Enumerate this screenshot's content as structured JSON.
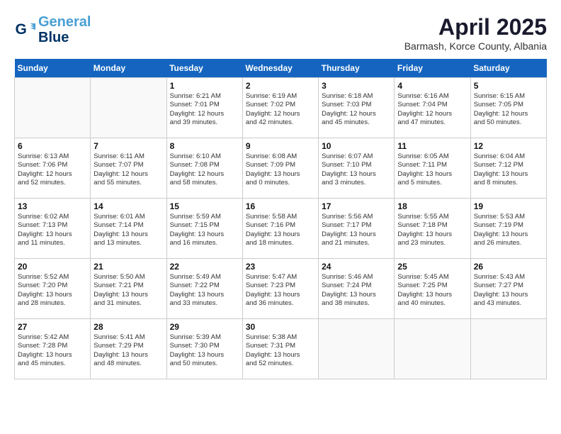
{
  "logo": {
    "line1": "General",
    "line2": "Blue"
  },
  "title": "April 2025",
  "subtitle": "Barmash, Korce County, Albania",
  "headers": [
    "Sunday",
    "Monday",
    "Tuesday",
    "Wednesday",
    "Thursday",
    "Friday",
    "Saturday"
  ],
  "weeks": [
    [
      {
        "day": "",
        "info": ""
      },
      {
        "day": "",
        "info": ""
      },
      {
        "day": "1",
        "info": "Sunrise: 6:21 AM\nSunset: 7:01 PM\nDaylight: 12 hours\nand 39 minutes."
      },
      {
        "day": "2",
        "info": "Sunrise: 6:19 AM\nSunset: 7:02 PM\nDaylight: 12 hours\nand 42 minutes."
      },
      {
        "day": "3",
        "info": "Sunrise: 6:18 AM\nSunset: 7:03 PM\nDaylight: 12 hours\nand 45 minutes."
      },
      {
        "day": "4",
        "info": "Sunrise: 6:16 AM\nSunset: 7:04 PM\nDaylight: 12 hours\nand 47 minutes."
      },
      {
        "day": "5",
        "info": "Sunrise: 6:15 AM\nSunset: 7:05 PM\nDaylight: 12 hours\nand 50 minutes."
      }
    ],
    [
      {
        "day": "6",
        "info": "Sunrise: 6:13 AM\nSunset: 7:06 PM\nDaylight: 12 hours\nand 52 minutes."
      },
      {
        "day": "7",
        "info": "Sunrise: 6:11 AM\nSunset: 7:07 PM\nDaylight: 12 hours\nand 55 minutes."
      },
      {
        "day": "8",
        "info": "Sunrise: 6:10 AM\nSunset: 7:08 PM\nDaylight: 12 hours\nand 58 minutes."
      },
      {
        "day": "9",
        "info": "Sunrise: 6:08 AM\nSunset: 7:09 PM\nDaylight: 13 hours\nand 0 minutes."
      },
      {
        "day": "10",
        "info": "Sunrise: 6:07 AM\nSunset: 7:10 PM\nDaylight: 13 hours\nand 3 minutes."
      },
      {
        "day": "11",
        "info": "Sunrise: 6:05 AM\nSunset: 7:11 PM\nDaylight: 13 hours\nand 5 minutes."
      },
      {
        "day": "12",
        "info": "Sunrise: 6:04 AM\nSunset: 7:12 PM\nDaylight: 13 hours\nand 8 minutes."
      }
    ],
    [
      {
        "day": "13",
        "info": "Sunrise: 6:02 AM\nSunset: 7:13 PM\nDaylight: 13 hours\nand 11 minutes."
      },
      {
        "day": "14",
        "info": "Sunrise: 6:01 AM\nSunset: 7:14 PM\nDaylight: 13 hours\nand 13 minutes."
      },
      {
        "day": "15",
        "info": "Sunrise: 5:59 AM\nSunset: 7:15 PM\nDaylight: 13 hours\nand 16 minutes."
      },
      {
        "day": "16",
        "info": "Sunrise: 5:58 AM\nSunset: 7:16 PM\nDaylight: 13 hours\nand 18 minutes."
      },
      {
        "day": "17",
        "info": "Sunrise: 5:56 AM\nSunset: 7:17 PM\nDaylight: 13 hours\nand 21 minutes."
      },
      {
        "day": "18",
        "info": "Sunrise: 5:55 AM\nSunset: 7:18 PM\nDaylight: 13 hours\nand 23 minutes."
      },
      {
        "day": "19",
        "info": "Sunrise: 5:53 AM\nSunset: 7:19 PM\nDaylight: 13 hours\nand 26 minutes."
      }
    ],
    [
      {
        "day": "20",
        "info": "Sunrise: 5:52 AM\nSunset: 7:20 PM\nDaylight: 13 hours\nand 28 minutes."
      },
      {
        "day": "21",
        "info": "Sunrise: 5:50 AM\nSunset: 7:21 PM\nDaylight: 13 hours\nand 31 minutes."
      },
      {
        "day": "22",
        "info": "Sunrise: 5:49 AM\nSunset: 7:22 PM\nDaylight: 13 hours\nand 33 minutes."
      },
      {
        "day": "23",
        "info": "Sunrise: 5:47 AM\nSunset: 7:23 PM\nDaylight: 13 hours\nand 36 minutes."
      },
      {
        "day": "24",
        "info": "Sunrise: 5:46 AM\nSunset: 7:24 PM\nDaylight: 13 hours\nand 38 minutes."
      },
      {
        "day": "25",
        "info": "Sunrise: 5:45 AM\nSunset: 7:25 PM\nDaylight: 13 hours\nand 40 minutes."
      },
      {
        "day": "26",
        "info": "Sunrise: 5:43 AM\nSunset: 7:27 PM\nDaylight: 13 hours\nand 43 minutes."
      }
    ],
    [
      {
        "day": "27",
        "info": "Sunrise: 5:42 AM\nSunset: 7:28 PM\nDaylight: 13 hours\nand 45 minutes."
      },
      {
        "day": "28",
        "info": "Sunrise: 5:41 AM\nSunset: 7:29 PM\nDaylight: 13 hours\nand 48 minutes."
      },
      {
        "day": "29",
        "info": "Sunrise: 5:39 AM\nSunset: 7:30 PM\nDaylight: 13 hours\nand 50 minutes."
      },
      {
        "day": "30",
        "info": "Sunrise: 5:38 AM\nSunset: 7:31 PM\nDaylight: 13 hours\nand 52 minutes."
      },
      {
        "day": "",
        "info": ""
      },
      {
        "day": "",
        "info": ""
      },
      {
        "day": "",
        "info": ""
      }
    ]
  ]
}
